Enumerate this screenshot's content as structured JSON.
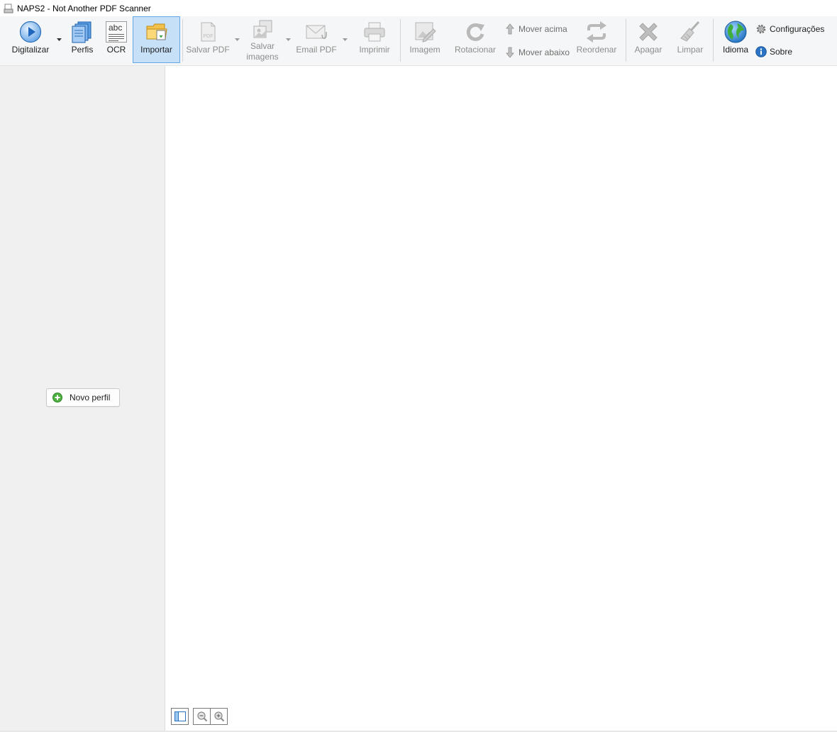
{
  "window": {
    "title": "NAPS2 - Not Another PDF Scanner"
  },
  "toolbar": {
    "scan": "Digitalizar",
    "profiles": "Perfis",
    "ocr": "OCR",
    "import": "Importar",
    "save_pdf": "Salvar PDF",
    "save_images_1": "Salvar",
    "save_images_2": "imagens",
    "email_pdf": "Email PDF",
    "print": "Imprimir",
    "image": "Imagem",
    "rotate": "Rotacionar",
    "move_up": "Mover acima",
    "move_down": "Mover abaixo",
    "reorder": "Reordenar",
    "delete": "Apagar",
    "clear": "Limpar",
    "language": "Idioma",
    "settings": "Configurações",
    "about": "Sobre",
    "ocr_icon_text": "abc"
  },
  "sidebar": {
    "new_profile": "Novo perfil"
  },
  "colors": {
    "active_bg": "#c5e0f7",
    "active_border": "#62a8e5",
    "disabled_text": "#8d8d8d",
    "accent_blue": "#2a73c5"
  }
}
